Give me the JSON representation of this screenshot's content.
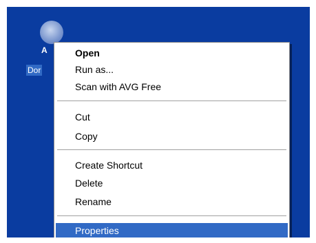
{
  "desktop": {
    "background_color": "#0a3ca0",
    "icon": {
      "name": "desktop-file-icon",
      "label": "Dor"
    }
  },
  "context_menu": {
    "highlight_color": "#316ac5",
    "items": [
      {
        "label": "Open",
        "bold": true,
        "selected": false
      },
      {
        "label": "Run as...",
        "bold": false,
        "selected": false
      },
      {
        "label": "Scan with AVG Free",
        "bold": false,
        "selected": false
      },
      {
        "label": "Cut",
        "bold": false,
        "selected": false
      },
      {
        "label": "Copy",
        "bold": false,
        "selected": false
      },
      {
        "label": "Create Shortcut",
        "bold": false,
        "selected": false
      },
      {
        "label": "Delete",
        "bold": false,
        "selected": false
      },
      {
        "label": "Rename",
        "bold": false,
        "selected": false
      },
      {
        "label": "Properties",
        "bold": false,
        "selected": true
      }
    ]
  }
}
